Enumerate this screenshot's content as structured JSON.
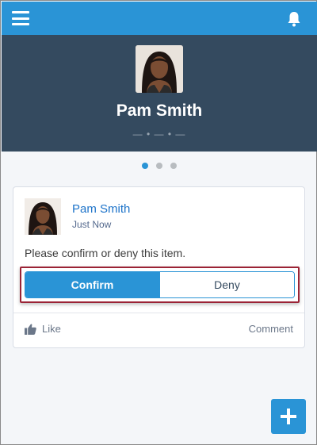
{
  "topbar": {
    "color": "#2a94d6",
    "menu_icon": "hamburger-menu-icon",
    "notification_icon": "bell-icon"
  },
  "profile": {
    "name": "Pam Smith",
    "ornament": "— • — • —"
  },
  "carousel": {
    "pages": 3,
    "active_index": 0
  },
  "post": {
    "author": "Pam Smith",
    "time": "Just Now",
    "text": "Please confirm or deny this item.",
    "confirm_label": "Confirm",
    "deny_label": "Deny",
    "like_label": "Like",
    "comment_label": "Comment"
  },
  "fab": {
    "icon": "plus-icon"
  }
}
